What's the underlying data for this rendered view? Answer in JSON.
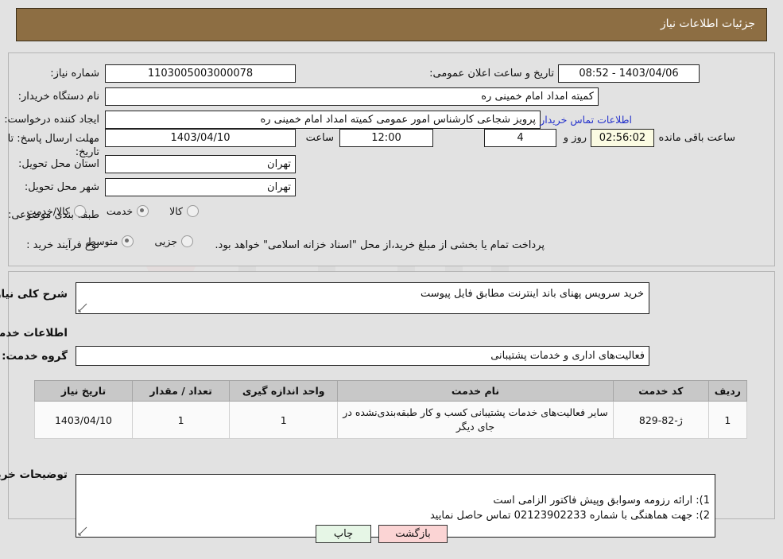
{
  "header": {
    "title": "جزئیات اطلاعات نیاز"
  },
  "form": {
    "need_number_label": "شماره نیاز:",
    "need_number_value": "1103005003000078",
    "announce_label": "تاریخ و ساعت اعلان عمومی:",
    "announce_value": "1403/04/06 - 08:52",
    "buyer_org_label": "نام دستگاه خریدار:",
    "buyer_org_value": "کمیته امداد امام خمینی ره",
    "requester_label": "ایجاد کننده درخواست:",
    "requester_value": "پرویز شجاعی کارشناس امور عمومی کمیته امداد امام خمینی ره",
    "contact_link": "اطلاعات تماس خریدار",
    "deadline_label": "مهلت ارسال پاسخ: تا تاریخ:",
    "deadline_date": "1403/04/10",
    "deadline_hour_label": "ساعت",
    "deadline_hour_value": "12:00",
    "days_value": "4",
    "days_text": "روز و",
    "timer_value": "02:56:02",
    "remaining_text": "ساعت باقی مانده",
    "province_label": "استان محل تحویل:",
    "province_value": "تهران",
    "city_label": "شهر محل تحویل:",
    "city_value": "تهران",
    "category_label": "طبقه بندی موضوعی:",
    "category_options": [
      {
        "label": "کالا",
        "selected": false
      },
      {
        "label": "خدمت",
        "selected": true
      },
      {
        "label": "کالا/خدمت",
        "selected": false
      }
    ],
    "purchase_type_label": "نوع فرآیند خرید :",
    "purchase_type_options": [
      {
        "label": "جزیی",
        "selected": true
      },
      {
        "label": "متوسط",
        "selected": false
      }
    ],
    "treasury_note": "پرداخت تمام یا بخشی از مبلغ خرید،از محل \"اسناد خزانه اسلامی\" خواهد بود."
  },
  "details": {
    "general_desc_label": "شرح کلی نیاز:",
    "general_desc_value": "خرید سرویس پهنای باند اینترنت مطابق فایل پیوست",
    "services_heading": "اطلاعات خدمات مورد نیاز",
    "service_group_label": "گروه خدمت:",
    "service_group_value": "فعالیت‌های اداری و خدمات پشتیبانی",
    "buyer_notes_label": "توضیحات خریدار:",
    "buyer_notes_value": "1): ارائه رزومه وسوابق وپیش فاکتور الزامی است\n2): جهت هماهنگی با شماره 02123902233 تماس حاصل نمایید"
  },
  "table": {
    "columns": [
      "ردیف",
      "کد خدمت",
      "نام خدمت",
      "واحد اندازه گیری",
      "تعداد / مقدار",
      "تاریخ نیاز"
    ],
    "rows": [
      {
        "row": "1",
        "code": "ژ-82-829",
        "name": "سایر فعالیت‌های خدمات پشتیبانی کسب و کار طبقه‌بندی‌نشده در جای دیگر",
        "unit": "1",
        "qty": "1",
        "date": "1403/04/10"
      }
    ]
  },
  "footer": {
    "print_label": "چاپ",
    "back_label": "بازگشت"
  },
  "watermark": {
    "text": "AriaTenderprot"
  },
  "colors": {
    "header_bg": "#8d6e43",
    "page_bg": "#e2e2e2",
    "link": "#2633cc",
    "timer_bg": "#fbfbe2",
    "back_btn": "#fbd4d4",
    "print_btn": "#e6f6e6",
    "table_header": "#c8c8c8"
  }
}
